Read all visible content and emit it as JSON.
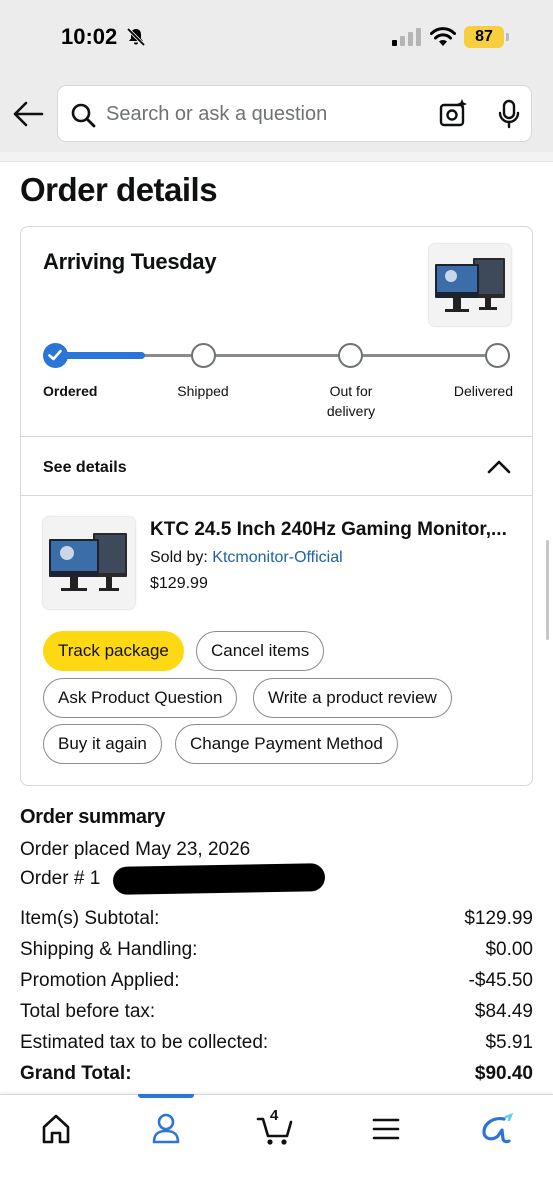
{
  "status_bar": {
    "time": "10:02",
    "battery": "87"
  },
  "search": {
    "placeholder": "Search or ask a question"
  },
  "page_title": "Order details",
  "shipment": {
    "arrival": "Arriving Tuesday",
    "progress": 0.2,
    "steps": [
      {
        "label": "Ordered",
        "done": true
      },
      {
        "label": "Shipped",
        "done": false
      },
      {
        "label": "Out for delivery",
        "done": false
      },
      {
        "label": "Delivered",
        "done": false
      }
    ],
    "see_details": "See details"
  },
  "product": {
    "title": "KTC 24.5 Inch 240Hz Gaming Monitor,...",
    "sold_by_label": "Sold by: ",
    "seller": "Ktcmonitor-Official",
    "price": "$129.99"
  },
  "actions": {
    "track_package": "Track package",
    "cancel_items": "Cancel items",
    "ask_question": "Ask Product Question",
    "write_review": "Write a product review",
    "buy_again": "Buy it again",
    "change_payment": "Change Payment Method"
  },
  "summary": {
    "heading": "Order summary",
    "order_placed": "Order placed May 23, 2026",
    "order_number_label": "Order # 1",
    "rows": [
      {
        "label": "Item(s) Subtotal:",
        "value": "$129.99"
      },
      {
        "label": "Shipping & Handling:",
        "value": "$0.00"
      },
      {
        "label": "Promotion Applied:",
        "value": "-$45.50"
      },
      {
        "label": "Total before tax:",
        "value": "$84.49"
      },
      {
        "label": "Estimated tax to be collected:",
        "value": "$5.91"
      },
      {
        "label": "Grand Total:",
        "value": "$90.40"
      }
    ]
  },
  "bottom_nav": {
    "items": [
      "home-icon",
      "account-icon",
      "cart-icon",
      "menu-icon",
      "rufus-icon"
    ],
    "active": "account-icon",
    "cart_count": "4"
  },
  "colors": {
    "accent": "#2b74d8",
    "primary_button": "#ffd814",
    "link": "#2162a1",
    "battery": "#f7cf3e"
  }
}
